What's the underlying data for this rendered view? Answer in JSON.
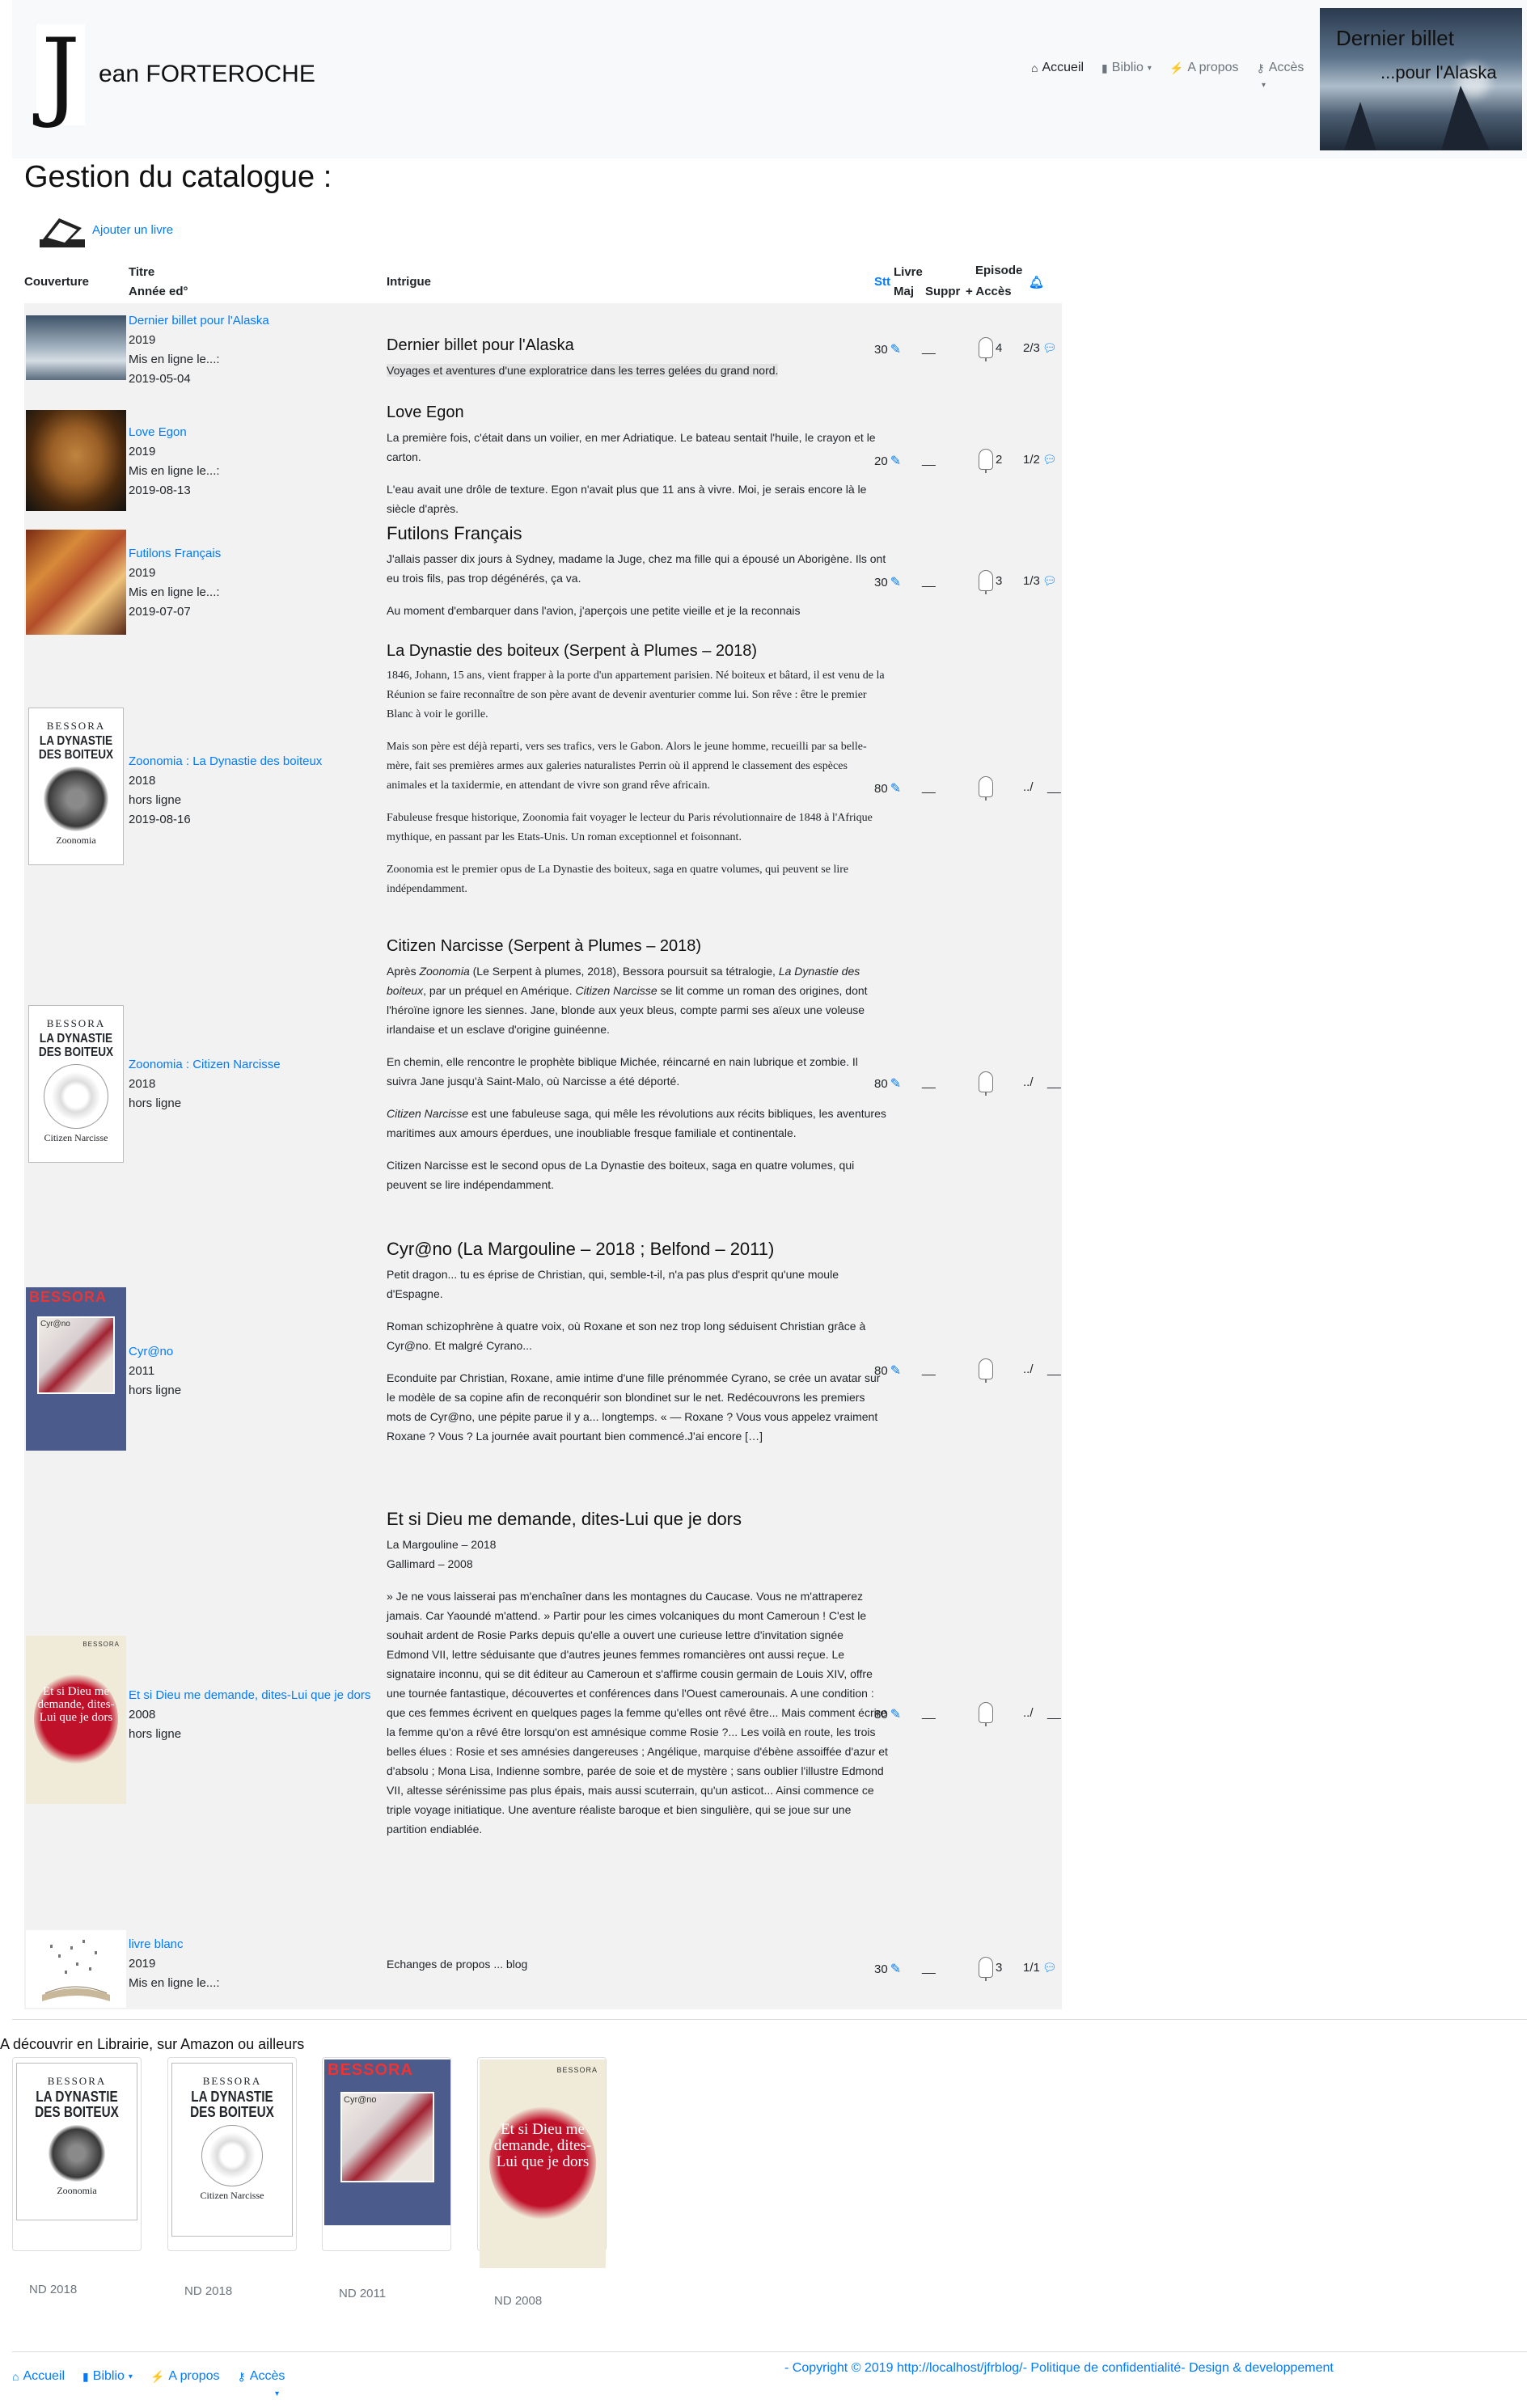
{
  "header": {
    "brand": "ean FORTEROCHE",
    "logo_letter": "J",
    "nav": {
      "home": "Accueil",
      "biblio": "Biblio",
      "about": "A propos",
      "access": "Accès"
    },
    "banner": {
      "line1": "Dernier billet",
      "line2": "...pour l'Alaska"
    }
  },
  "page": {
    "title": "Gestion du catalogue :",
    "add_book": "Ajouter un livre"
  },
  "table": {
    "headers": {
      "cover": "Couverture",
      "title": "Titre",
      "edition": "Année ed°",
      "plot": "Intrigue",
      "status": "Stt",
      "book": "Livre",
      "update": "Maj",
      "delete": "Suppr",
      "episode": "Episode",
      "access": "+ Accès"
    },
    "rows": [
      {
        "title": "Dernier billet pour l'Alaska",
        "year": "2019",
        "status": "Mis en ligne le...:",
        "date": "2019-05-04",
        "plot_title": "Dernier billet pour l'Alaska",
        "plot": [
          "Voyages et aventures d'une exploratrice dans les terres gelées du grand nord."
        ],
        "stt": "30",
        "suppr": "__",
        "episodes": "4",
        "comments": "2/3"
      },
      {
        "title": "Love Egon",
        "year": "2019",
        "status": "Mis en ligne le...:",
        "date": "2019-08-13",
        "plot_title": "Love Egon",
        "plot": [
          "La première fois, c'était dans un voilier, en mer Adriatique. Le bateau sentait l'huile, le crayon et le carton.",
          "L'eau avait une drôle de texture. Egon n'avait plus que 11 ans à vivre. Moi, je serais encore là le siècle d'après."
        ],
        "stt": "20",
        "suppr": "__",
        "episodes": "2",
        "comments": "1/2"
      },
      {
        "title": "Futilons Français",
        "year": "2019",
        "status": "Mis en ligne le...:",
        "date": "2019-07-07",
        "plot_title": "Futilons Français",
        "plot": [
          "J'allais passer dix jours à Sydney, madame la Juge, chez ma fille qui a épousé un Aborigène. Ils ont eu trois fils, pas trop dégénérés, ça va.",
          "Au moment d'embarquer dans l'avion, j'aperçois une petite vieille et je la reconnais"
        ],
        "stt": "30",
        "suppr": "__",
        "episodes": "3",
        "comments": "1/3"
      },
      {
        "title": "Zoonomia : La Dynastie des boiteux",
        "year": "2018",
        "status": "hors ligne",
        "date": "2019-08-16",
        "plot_title": "La Dynastie des boiteux      (Serpent à Plumes – 2018)",
        "plot": [
          "1846, Johann, 15 ans, vient frapper à la porte d'un appartement parisien. Né boiteux et bâtard, il est venu de la Réunion se faire reconnaître de son père avant de devenir aventurier comme lui. Son rêve : être le premier Blanc à voir le gorille.",
          "Mais son père est déjà reparti, vers ses trafics, vers le Gabon. Alors le jeune homme, recueilli par sa belle-mère, fait ses premières armes aux galeries naturalistes Perrin où il apprend le classement des espèces animales et la taxidermie, en attendant de vivre son grand rêve africain.",
          "Fabuleuse fresque historique, Zoonomia fait voyager le lecteur du Paris révolutionnaire de 1848 à l'Afrique mythique, en passant par les Etats-Unis. Un roman exceptionnel et foisonnant.",
          "Zoonomia est le premier opus de La Dynastie des boiteux, saga en quatre volumes, qui peuvent se lire indépendamment."
        ],
        "stt": "80",
        "suppr": "__",
        "episodes": "",
        "comments": "../",
        "access_dash": "__"
      },
      {
        "title": "Zoonomia : Citizen Narcisse",
        "year": "2018",
        "status": "hors ligne",
        "plot_title": "Citizen Narcisse  (Serpent à Plumes – 2018)",
        "plot_intro": "Après ",
        "plot_intro_em": "Zoonomia",
        "plot_intro_rest": " (Le Serpent à plumes, 2018), Bessora poursuit sa tétralogie, ",
        "plot_intro_em2": "La Dynastie des boiteux",
        "plot_intro_rest2": ", par un préquel en Amérique. ",
        "plot_intro_em3": "Citizen Narcisse",
        "plot_intro_rest3": " se lit comme un roman des origines, dont l'héroïne ignore les siennes. Jane, blonde aux yeux bleus, compte parmi ses aïeux une voleuse irlandaise et un esclave d'origine guinéenne.",
        "plot": [
          "En chemin, elle rencontre le prophète biblique Michée, réincarné en nain lubrique et zombie. Il suivra Jane jusqu'à Saint-Malo, où Narcisse a été déporté."
        ],
        "plot_em_start": "Citizen Narcisse",
        "plot_em_rest": " est une fabuleuse saga, qui mêle les révolutions aux récits bibliques, les aventures maritimes aux amours éperdues, une inoubliable fresque familiale et continentale.",
        "plot_end": "Citizen Narcisse est le second opus de La Dynastie des boiteux, saga en quatre volumes, qui peuvent se lire indépendamment.",
        "stt": "80",
        "suppr": "__",
        "comments": "../",
        "access_dash": "__"
      },
      {
        "title": "Cyr@no",
        "year": "2011",
        "status": "hors ligne",
        "plot_title": "Cyr@no (La Margouline – 2018 ; Belfond – 2011)",
        "plot": [
          "Petit dragon... tu es éprise de Christian, qui, semble-t-il, n'a pas plus d'esprit qu'une moule d'Espagne.",
          "Roman schizophrène à quatre voix, où Roxane et son nez trop long séduisent Christian grâce à Cyr@no. Et malgré Cyrano...",
          "Econduite par Christian, Roxane, amie intime d'une fille prénommée Cyrano, se crée un avatar sur le modèle de sa copine afin de reconquérir son blondinet sur le net. Redécouvrons les premiers mots de Cyr@no, une pépite parue il y a... longtemps. « — Roxane ? Vous vous appelez vraiment Roxane ? Vous ? La journée avait pourtant bien commencé.J'ai encore […]"
        ],
        "stt": "80",
        "suppr": "__",
        "comments": "../",
        "access_dash": "__"
      },
      {
        "title": "Et si Dieu me demande, dites-Lui que je dors",
        "year": "2008",
        "status": "hors ligne",
        "plot_title": "Et si Dieu me demande, dites-Lui que je dors",
        "plot_meta": [
          "La Margouline – 2018",
          "Gallimard – 2008"
        ],
        "plot": [
          "» Je ne vous laisserai pas m'enchaîner dans les montagnes du Caucase. Vous ne m'attraperez jamais. Car Yaoundé m'attend.  » Partir pour les cimes volcaniques du mont Cameroun ! C'est le souhait ardent de Rosie Parks depuis qu'elle a ouvert une curieuse lettre d'invitation signée Edmond VII, lettre séduisante que d'autres jeunes femmes romancières ont aussi reçue. Le signataire inconnu, qui se dit éditeur au Cameroun et s'affirme cousin germain de Louis XIV, offre une tournée fantastique, découvertes et conférences dans l'Ouest camerounais. A une condition : que ces femmes écrivent en quelques pages la femme qu'elles ont rêvé être... Mais comment écrire la femme qu'on a rêvé être lorsqu'on est amnésique comme Rosie ?... Les voilà en route, les trois belles élues : Rosie et ses amnésies dangereuses ; Angélique, marquise d'ébène assoiffée d'azur et d'absolu ; Mona Lisa, Indienne sombre, parée de soie et de mystère ; sans oublier l'illustre Edmond VII, altesse sérénissime pas plus épais, mais aussi scuterrain, qu'un asticot... Ainsi commence ce triple voyage initiatique. Une aventure réaliste baroque et bien singulière, qui se joue sur une partition endiablée."
        ],
        "stt": "80",
        "suppr": "__",
        "comments": "../",
        "access_dash": "__"
      },
      {
        "title": "livre blanc",
        "year": "2019",
        "status": "Mis en ligne le...:",
        "plot": [
          "Echanges de propos ... blog"
        ],
        "stt": "30",
        "suppr": "__",
        "episodes": "3",
        "comments": "1/1"
      }
    ]
  },
  "covers": {
    "bessora": "BESSORA",
    "dynastie": "LA DYNASTIE DES BOITEUX",
    "zoonomia": "Zoonomia",
    "citizen": "Citizen Narcisse",
    "cyrano": "Cyr@no",
    "bes": "BESSORA",
    "dieu": "Et si Dieu me demande, dites-Lui que je dors"
  },
  "showcase": {
    "title": "A découvrir en Librairie, sur Amazon ou ailleurs",
    "cards": [
      "ND 2018",
      "ND 2018",
      "ND 2011",
      "ND 2008"
    ]
  },
  "footer": {
    "home": "Accueil",
    "biblio": "Biblio",
    "about": "A propos",
    "access": "Accès",
    "copyright": "- Copyright © 2019 http://localhost/jfrblog/- Politique de confidentialité- Design & developpement"
  },
  "colors": {
    "link": "#007bff",
    "navbar": "#f8f9fa",
    "row_bg": "#f2f2f2"
  }
}
